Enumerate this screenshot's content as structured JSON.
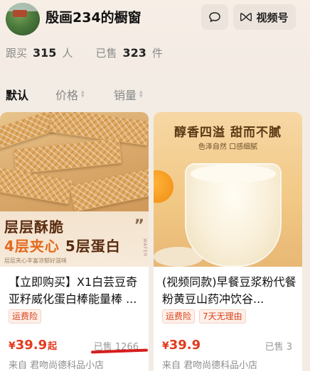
{
  "header": {
    "shop_name": "殷画234的橱窗",
    "message_icon": "chat-bubble-icon",
    "video_icon": "bowtie-icon",
    "video_label": "视频号"
  },
  "stats": {
    "follow_label": "跟买",
    "follow_count": "315",
    "follow_unit": "人",
    "sold_label": "已售",
    "sold_count": "323",
    "sold_unit": "件"
  },
  "sort": {
    "default_label": "默认",
    "price_label": "价格",
    "sales_label": "销量"
  },
  "products": [
    {
      "image_text": {
        "line1": "层层酥脆",
        "line2_a": "4层夹心",
        "line2_b": "5层蛋白",
        "line3": "层层夹心丰富浓郁好滋味",
        "quote": "”",
        "side": "WAFER"
      },
      "title": "【立即购买】X1白芸豆奇亚籽威化蛋白棒能量棒 ...",
      "tags": [
        "运费险"
      ],
      "price_currency": "¥",
      "price_value": "39.9",
      "price_suffix": "起",
      "sold": "已售 1266",
      "shop": "来自 君吻尚德科品小店"
    },
    {
      "image_text": {
        "line1": "醇香四溢  甜而不腻",
        "line2": "色泽自然  口感细腻"
      },
      "title": "(视频同款)早餐豆浆粉代餐粉黄豆山药冲饮谷...",
      "tags": [
        "运费险",
        "7天无理由"
      ],
      "price_currency": "¥",
      "price_value": "39.9",
      "price_suffix": "",
      "sold": "已售 3",
      "shop": "来自 君吻尚德科品小店"
    }
  ],
  "colors": {
    "price": "#e23a1d",
    "tag_text": "#d9431c",
    "annotation_line": "#d61d1d",
    "background": "#f3ece4"
  }
}
